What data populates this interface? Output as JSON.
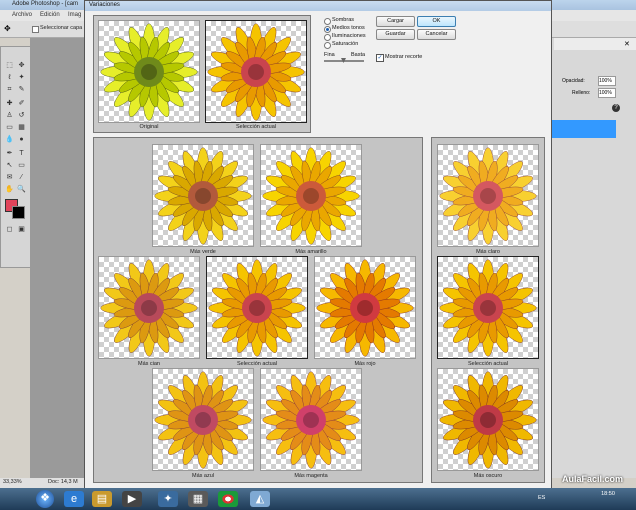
{
  "ps": {
    "title": "Adobe Photoshop - [cam",
    "menu": [
      "Archivo",
      "Edición",
      "Imag"
    ],
    "options_checkbox_label": "Seleccionar capa",
    "zoom": "33,33%",
    "doc_info": "Doc: 14,3 M",
    "panels": {
      "opacity_label": "Opacidad:",
      "opacity_value": "100%",
      "fill_label": "Relleno:",
      "fill_value": "100%"
    }
  },
  "dialog": {
    "title": "Variaciones",
    "original_caption": "Original",
    "current_caption": "Selección actual",
    "options": [
      {
        "label": "Sombras",
        "selected": false
      },
      {
        "label": "Medios tonos",
        "selected": true
      },
      {
        "label": "Iluminaciones",
        "selected": false
      },
      {
        "label": "Saturación",
        "selected": false
      }
    ],
    "fine_label": "Fina",
    "coarse_label": "Basta",
    "show_clipping_label": "Mostrar recorte",
    "show_clipping_checked": true,
    "buttons": {
      "ok": "OK",
      "cancel": "Cancelar",
      "load": "Cargar",
      "save": "Guardar"
    },
    "variations": {
      "more_green": "Más verde",
      "more_yellow": "Más amarillo",
      "more_cyan": "Más cian",
      "current_pick": "Selección actual",
      "more_red": "Más rojo",
      "more_blue": "Más azul",
      "more_magenta": "Más magenta"
    },
    "brightness": {
      "lighter": "Más claro",
      "current_pick": "Selección actual",
      "darker": "Más oscuro"
    }
  },
  "taskbar": {
    "lang": "ES",
    "time": "18:50"
  },
  "watermark": "AulaFacil.com"
}
